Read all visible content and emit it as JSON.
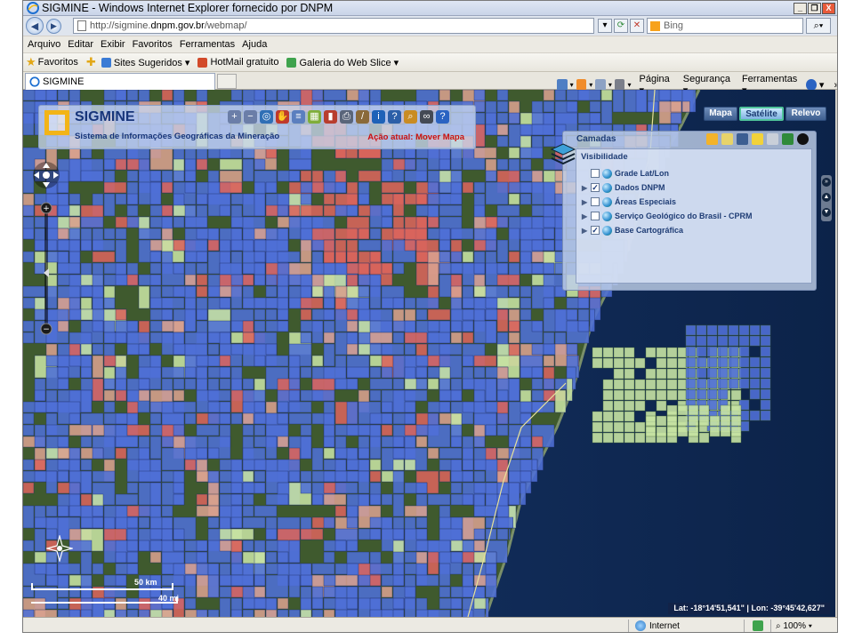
{
  "window": {
    "title": "SIGMINE - Windows Internet Explorer fornecido por DNPM",
    "controls": {
      "minimize": "_",
      "maximize": "❐",
      "close": "X"
    }
  },
  "address": {
    "url_prefix": "http://sigmine.",
    "url_domain": "dnpm.gov.br",
    "url_path": "/webmap/",
    "search_placeholder": "Bing"
  },
  "menu": [
    "Arquivo",
    "Editar",
    "Exibir",
    "Favoritos",
    "Ferramentas",
    "Ajuda"
  ],
  "favorites": {
    "favorites_label": "Favoritos",
    "links": [
      {
        "label": "Sites Sugeridos ▾",
        "color": "#3a7bd5"
      },
      {
        "label": "HotMail gratuito",
        "color": "#d24a2a"
      },
      {
        "label": "Galeria do Web Slice ▾",
        "color": "#3fa34d"
      }
    ]
  },
  "tab": {
    "label": "SIGMINE"
  },
  "command_bar": {
    "page": "Página ▾",
    "security": "Segurança ▾",
    "tools": "Ferramentas ▾",
    "help": "▾",
    "more": "»"
  },
  "app": {
    "name": "SIGMINE",
    "subtitle": "Sistema de Informações Geográficas da Mineração",
    "action_status": "Ação atual: Mover Mapa",
    "toolbar": [
      {
        "name": "zoom-in-tool-icon",
        "glyph": "+",
        "color": "#6b7ea8"
      },
      {
        "name": "zoom-out-tool-icon",
        "glyph": "−",
        "color": "#6b7ea8"
      },
      {
        "name": "zoom-extent-tool-icon",
        "glyph": "◎",
        "color": "#2f6fb5"
      },
      {
        "name": "pan-hand-tool-icon",
        "glyph": "✋",
        "color": "#c0392b"
      },
      {
        "name": "layers-tool-icon",
        "glyph": "≡",
        "color": "#5b7fbf"
      },
      {
        "name": "map-tool-icon",
        "glyph": "▦",
        "color": "#7fae3a"
      },
      {
        "name": "bookmark-tool-icon",
        "glyph": "▮",
        "color": "#b83d2e"
      },
      {
        "name": "print-tool-icon",
        "glyph": "⎙",
        "color": "#59657a"
      },
      {
        "name": "measure-tool-icon",
        "glyph": "/",
        "color": "#8a6a3a"
      },
      {
        "name": "identify-tool-icon",
        "glyph": "i",
        "color": "#1e62b8"
      },
      {
        "name": "query-tool-icon",
        "glyph": "?",
        "color": "#2b5fa8"
      },
      {
        "name": "search-tool-icon",
        "glyph": "⌕",
        "color": "#c98c23"
      },
      {
        "name": "link-tool-icon",
        "glyph": "∞",
        "color": "#444a55"
      },
      {
        "name": "help-tool-icon",
        "glyph": "?",
        "color": "#2a63c2"
      }
    ]
  },
  "map_types": [
    {
      "label": "Mapa",
      "active": false
    },
    {
      "label": "Satélite",
      "active": true
    },
    {
      "label": "Relevo",
      "active": false
    }
  ],
  "layers_panel": {
    "title": "Camadas",
    "visibility_label": "Visibilidade",
    "layers": [
      {
        "label": "Grade Lat/Lon",
        "checked": false,
        "expandable": false
      },
      {
        "label": "Dados DNPM",
        "checked": true,
        "expandable": true
      },
      {
        "label": "Áreas Especiais",
        "checked": false,
        "expandable": true
      },
      {
        "label": "Serviço Geológico do Brasil - CPRM",
        "checked": false,
        "expandable": true
      },
      {
        "label": "Base Cartográfica",
        "checked": true,
        "expandable": true
      }
    ]
  },
  "scale": {
    "km_label": "50 km",
    "mi_label": "40 mi"
  },
  "coordinates": "Lat: -18°14'51,541\" | Lon: -39°45'42,627\"",
  "status": {
    "zone": "Internet",
    "zoom": "100%"
  },
  "colors": {
    "blue_claim": "#4f6fd6",
    "red_claim": "#d9645c",
    "salmon_claim": "#d8a08e",
    "green_claim": "#c7e3a3",
    "ocean": "#0e2a55",
    "land": "#3e5a2c"
  }
}
